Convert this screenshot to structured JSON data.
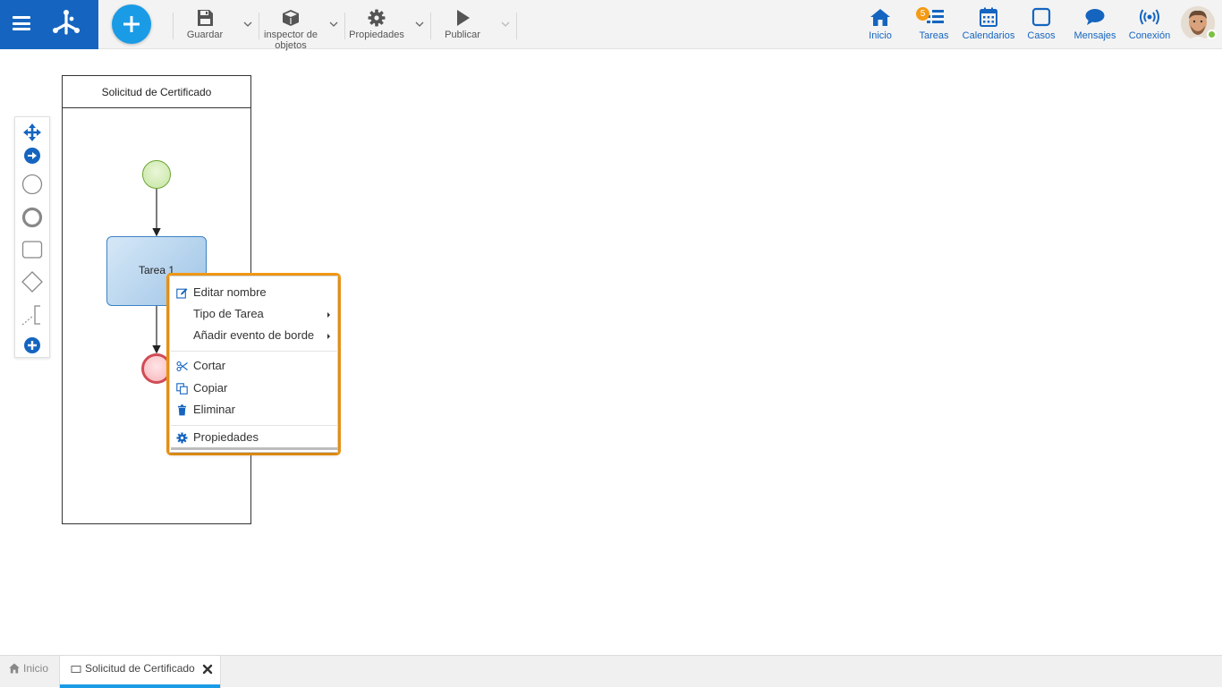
{
  "toolbar": {
    "save_label": "Guardar",
    "inspector_label_line1": "inspector de",
    "inspector_label_line2": "objetos",
    "properties_label": "Propiedades",
    "publish_label": "Publicar"
  },
  "nav": {
    "home_label": "Inicio",
    "tasks_label": "Tareas",
    "tasks_badge": "5",
    "calendars_label": "Calendarios",
    "cases_label": "Casos",
    "messages_label": "Mensajes",
    "connection_label": "Conexión"
  },
  "diagram": {
    "pool_title": "Solicitud de Certificado",
    "task_label": "Tarea 1"
  },
  "context_menu": {
    "edit_name": "Editar nombre",
    "task_type": "Tipo de Tarea",
    "add_boundary_event": "Añadir evento de borde",
    "cut": "Cortar",
    "copy": "Copiar",
    "delete": "Eliminar",
    "properties": "Propiedades"
  },
  "tabs": {
    "home_label": "Inicio",
    "active_label": "Solicitud de Certificado"
  },
  "colors": {
    "brand_blue": "#1565c0",
    "accent_blue": "#1a9be6",
    "highlight_orange": "#f39a16",
    "badge_orange": "#f59a12",
    "online_green": "#7cc143"
  }
}
